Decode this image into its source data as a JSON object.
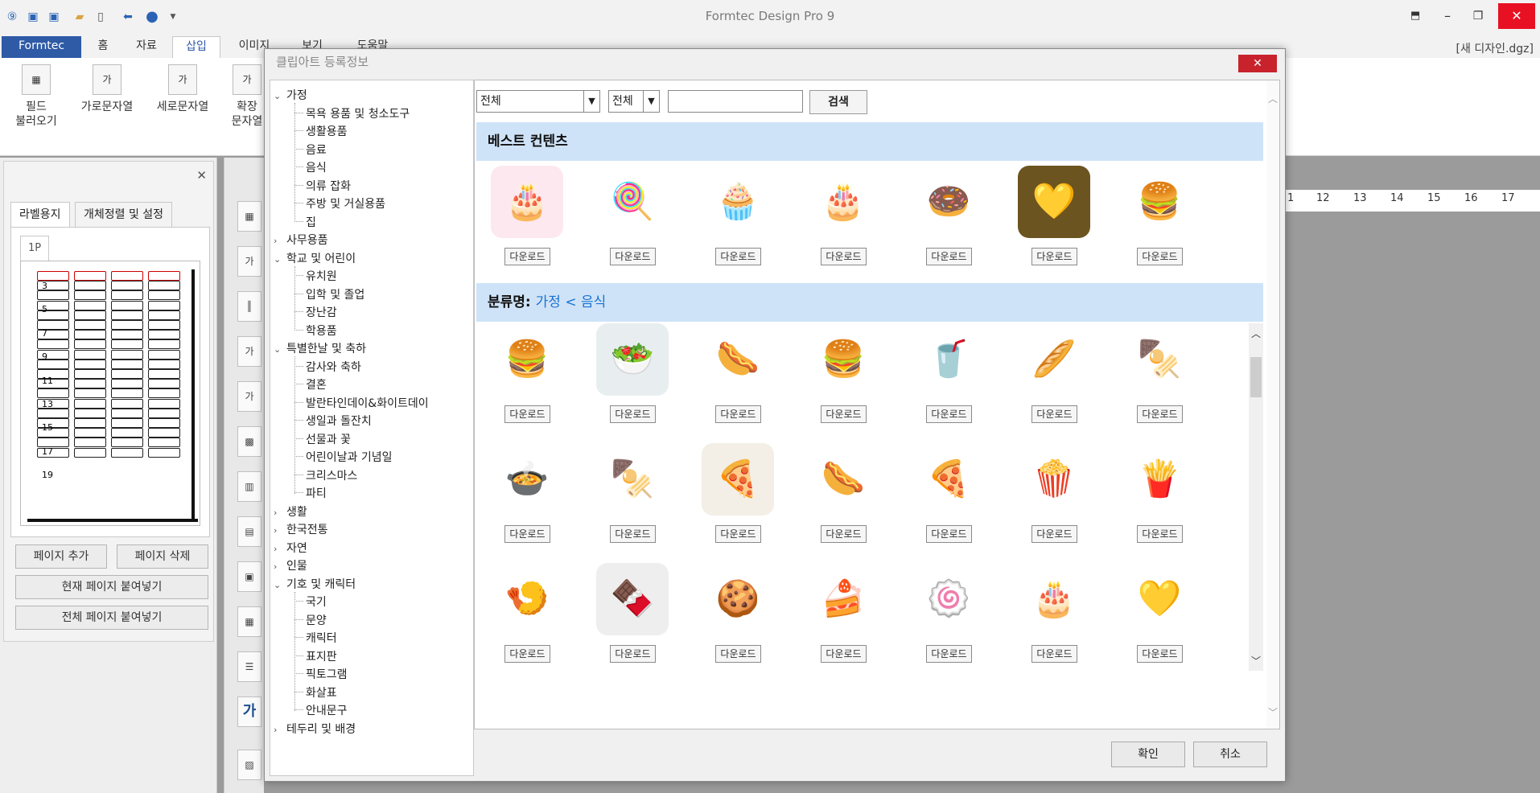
{
  "app": {
    "title": "Formtec Design Pro 9",
    "document_name": "[새 디자인.dgz]"
  },
  "menu": {
    "formtec": "Formtec",
    "home": "홈",
    "data": "자료",
    "insert": "삽입",
    "image": "이미지",
    "view": "보기",
    "help": "도움말"
  },
  "ribbon": {
    "items": [
      {
        "label": "필드\n불러오기",
        "icon": "field-load-icon",
        "glyph": "▦"
      },
      {
        "label": "가로문자열",
        "icon": "horizontal-text-icon",
        "glyph": "가"
      },
      {
        "label": "세로문자열",
        "icon": "vertical-text-icon",
        "glyph": "가"
      },
      {
        "label": "확장\n문자열",
        "icon": "extended-text-icon",
        "glyph": "가"
      }
    ]
  },
  "left_panel": {
    "tab_label_paper": "라벨용지",
    "tab_align": "개체정렬 및 설정",
    "page_tab": "1P",
    "row_numbers": [
      "3",
      "5",
      "7",
      "9",
      "11",
      "13",
      "15",
      "17",
      "19"
    ],
    "add_page": "페이지 추가",
    "delete_page": "페이지 삭제",
    "paste_current": "현재 페이지 붙여넣기",
    "paste_all": "전체 페이지 붙여넣기"
  },
  "ruler": {
    "numbers": [
      "1",
      "12",
      "13",
      "14",
      "15",
      "16",
      "17"
    ]
  },
  "dialog": {
    "title": "클립아트 등록정보",
    "ok": "확인",
    "cancel": "취소",
    "tree": [
      {
        "label": "가정",
        "expanded": true,
        "children": [
          "목욕 용품 및 청소도구",
          "생활용품",
          "음료",
          "음식",
          "의류 잡화",
          "주방 및 거실용품",
          "집"
        ]
      },
      {
        "label": "사무용품",
        "expanded": false,
        "children": []
      },
      {
        "label": "학교 및 어린이",
        "expanded": true,
        "children": [
          "유치원",
          "입학 및 졸업",
          "장난감",
          "학용품"
        ]
      },
      {
        "label": "특별한날 및 축하",
        "expanded": true,
        "children": [
          "감사와 축하",
          "결혼",
          "발란타인데이&화이트데이",
          "생일과 돌잔치",
          "선물과 꽃",
          "어린이날과 기념일",
          "크리스마스",
          "파티"
        ]
      },
      {
        "label": "생활",
        "expanded": false,
        "children": []
      },
      {
        "label": "한국전통",
        "expanded": false,
        "children": []
      },
      {
        "label": "자연",
        "expanded": false,
        "children": []
      },
      {
        "label": "인물",
        "expanded": false,
        "children": []
      },
      {
        "label": "기호 및 캐릭터",
        "expanded": true,
        "children": [
          "국기",
          "문양",
          "캐릭터",
          "표지판",
          "픽토그램",
          "화살표",
          "안내문구"
        ]
      },
      {
        "label": "테두리 및 배경",
        "expanded": false,
        "children": []
      }
    ],
    "filter1": "전체",
    "filter2": "전체",
    "search_value": "",
    "search_button": "검색",
    "best_header": "베스트 컨텐츠",
    "category_prefix": "분류명:",
    "category_path": "가정 < 음식",
    "download_label": "다운로드",
    "best_items": [
      {
        "name": "birthday-cake-candles",
        "emoji": "🎂",
        "bg": "#fde8ef"
      },
      {
        "name": "lollipop",
        "emoji": "🍭",
        "bg": "#fff"
      },
      {
        "name": "cupcake-cherry",
        "emoji": "🧁",
        "bg": "#fff"
      },
      {
        "name": "pink-birthday-cake",
        "emoji": "🎂",
        "bg": "#fff"
      },
      {
        "name": "pink-donut",
        "emoji": "🍩",
        "bg": "#fff"
      },
      {
        "name": "love-heart-chocolate",
        "emoji": "💛",
        "bg": "#6b5420"
      },
      {
        "name": "hamburger",
        "emoji": "🍔",
        "bg": "#fff"
      }
    ],
    "food_items": [
      {
        "name": "hamburger",
        "emoji": "🍔",
        "bg": "#fff"
      },
      {
        "name": "sandwich-plate",
        "emoji": "🥗",
        "bg": "#e8eef0"
      },
      {
        "name": "hotdog-steam",
        "emoji": "🌭",
        "bg": "#fff"
      },
      {
        "name": "burger-drink",
        "emoji": "🍔",
        "bg": "#fff"
      },
      {
        "name": "burger-set",
        "emoji": "🥤",
        "bg": "#fff"
      },
      {
        "name": "sub-sandwich",
        "emoji": "🥖",
        "bg": "#fff"
      },
      {
        "name": "corn-dogs",
        "emoji": "🍢",
        "bg": "#fff"
      },
      {
        "name": "stew-bowl",
        "emoji": "🍲",
        "bg": "#fff"
      },
      {
        "name": "fish-cake-skewers",
        "emoji": "🍢",
        "bg": "#fff"
      },
      {
        "name": "pizza-whole",
        "emoji": "🍕",
        "bg": "#f3efe6"
      },
      {
        "name": "corn-dog-pair",
        "emoji": "🌭",
        "bg": "#fff"
      },
      {
        "name": "pizza-slice-cut",
        "emoji": "🍕",
        "bg": "#fff"
      },
      {
        "name": "popcorn",
        "emoji": "🍿",
        "bg": "#fff"
      },
      {
        "name": "french-fries",
        "emoji": "🍟",
        "bg": "#fff"
      },
      {
        "name": "fried-shrimp",
        "emoji": "🍤",
        "bg": "#fff"
      },
      {
        "name": "chocolate-eclairs",
        "emoji": "🍫",
        "bg": "#eee"
      },
      {
        "name": "cookies-plate",
        "emoji": "🍪",
        "bg": "#fff"
      },
      {
        "name": "cake-slice",
        "emoji": "🍰",
        "bg": "#fff"
      },
      {
        "name": "roll-cake",
        "emoji": "🍥",
        "bg": "#fff"
      },
      {
        "name": "chocolate-heart-cake",
        "emoji": "🎂",
        "bg": "#fff"
      },
      {
        "name": "love-heart-chocolate",
        "emoji": "💛",
        "bg": "#fff"
      }
    ]
  },
  "colors": {
    "accent": "#2e5aa6",
    "close_red": "#c8232c",
    "section_bg": "#cfe3f8",
    "category_blue": "#1a73d0"
  }
}
